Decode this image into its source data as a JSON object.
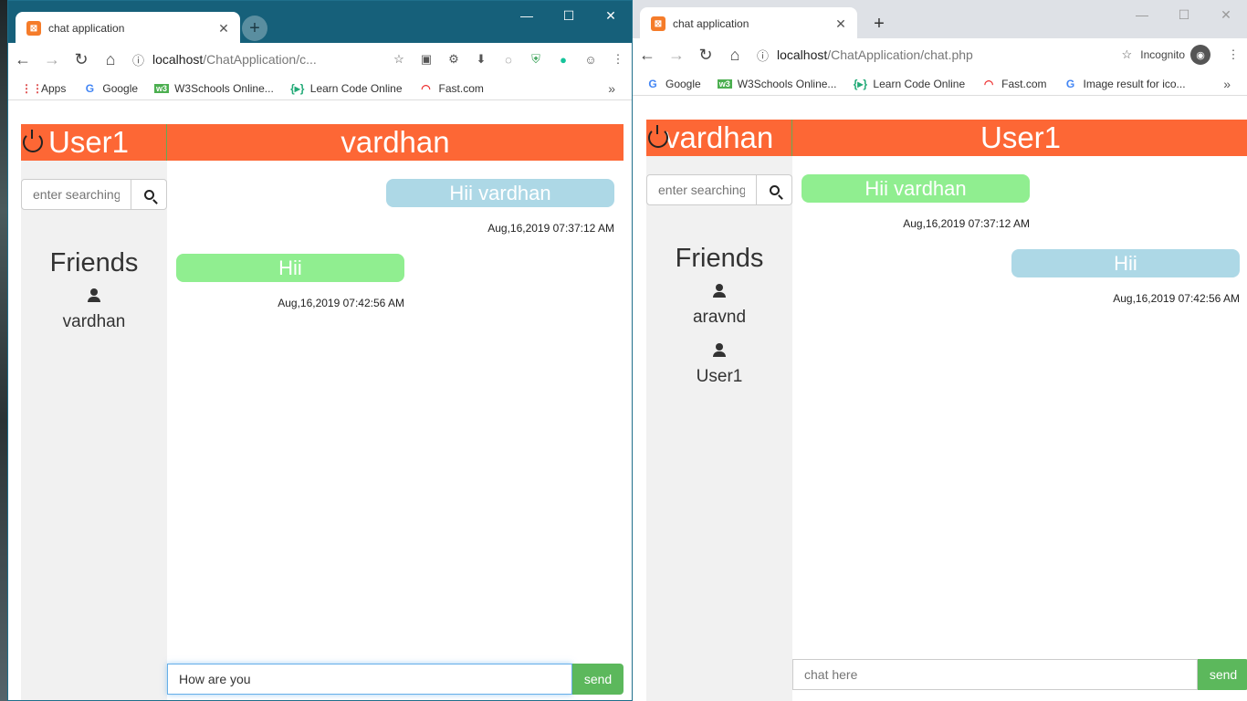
{
  "left_window": {
    "tab_title": "chat application",
    "tab_close": "✕",
    "new_tab": "+",
    "controls": {
      "minimize": "—",
      "maximize": "☐",
      "close": "✕"
    },
    "nav": {
      "back": "←",
      "forward": "→",
      "reload": "↻",
      "home": "⌂"
    },
    "url_host": "localhost",
    "url_path": "/ChatApplication/c...",
    "bookmarks": [
      {
        "label": "Apps",
        "icon": "apps-grid-icon"
      },
      {
        "label": "Google",
        "icon": "google-icon"
      },
      {
        "label": "W3Schools Online...",
        "icon": "w3schools-icon"
      },
      {
        "label": "Learn Code Online",
        "icon": "code-icon"
      },
      {
        "label": "Fast.com",
        "icon": "speed-icon"
      }
    ],
    "bookmarks_more": "»",
    "chat": {
      "current_user": "User1",
      "chat_partner": "vardhan",
      "search_placeholder": "enter searching",
      "friends_title": "Friends",
      "friends": [
        "vardhan"
      ],
      "messages": [
        {
          "text": "Hii vardhan",
          "time": "Aug,16,2019 07:37:12 AM",
          "side": "right",
          "color": "#add8e6"
        },
        {
          "text": "Hii",
          "time": "Aug,16,2019 07:42:56 AM",
          "side": "left",
          "color": "#90ee90"
        }
      ],
      "composer_value": "How are you",
      "send_label": "send"
    }
  },
  "right_window": {
    "tab_title": "chat application",
    "tab_close": "✕",
    "new_tab": "+",
    "controls": {
      "minimize": "—",
      "maximize": "☐",
      "close": "✕"
    },
    "nav": {
      "back": "←",
      "forward": "→",
      "reload": "↻",
      "home": "⌂"
    },
    "url_host": "localhost",
    "url_path": "/ChatApplication/chat.php",
    "incognito_label": "Incognito",
    "bookmarks": [
      {
        "label": "Google",
        "icon": "google-icon"
      },
      {
        "label": "W3Schools Online...",
        "icon": "w3schools-icon"
      },
      {
        "label": "Learn Code Online",
        "icon": "code-icon"
      },
      {
        "label": "Fast.com",
        "icon": "speed-icon"
      },
      {
        "label": "Image result for ico...",
        "icon": "google-icon"
      }
    ],
    "bookmarks_more": "»",
    "chat": {
      "current_user": "vardhan",
      "chat_partner": "User1",
      "search_placeholder": "enter searching",
      "friends_title": "Friends",
      "friends": [
        "aravnd",
        "User1"
      ],
      "messages": [
        {
          "text": "Hii vardhan",
          "time": "Aug,16,2019 07:37:12 AM",
          "side": "left",
          "color": "#90ee90"
        },
        {
          "text": "Hii",
          "time": "Aug,16,2019 07:42:56 AM",
          "side": "right",
          "color": "#add8e6"
        }
      ],
      "composer_placeholder": "chat here",
      "send_label": "send"
    }
  },
  "colors": {
    "header_orange": "#fd6735",
    "bubble_blue": "#add8e6",
    "bubble_green": "#90ee90",
    "send_green": "#5cb85c",
    "sidebar_gray": "#f1f1f1"
  }
}
